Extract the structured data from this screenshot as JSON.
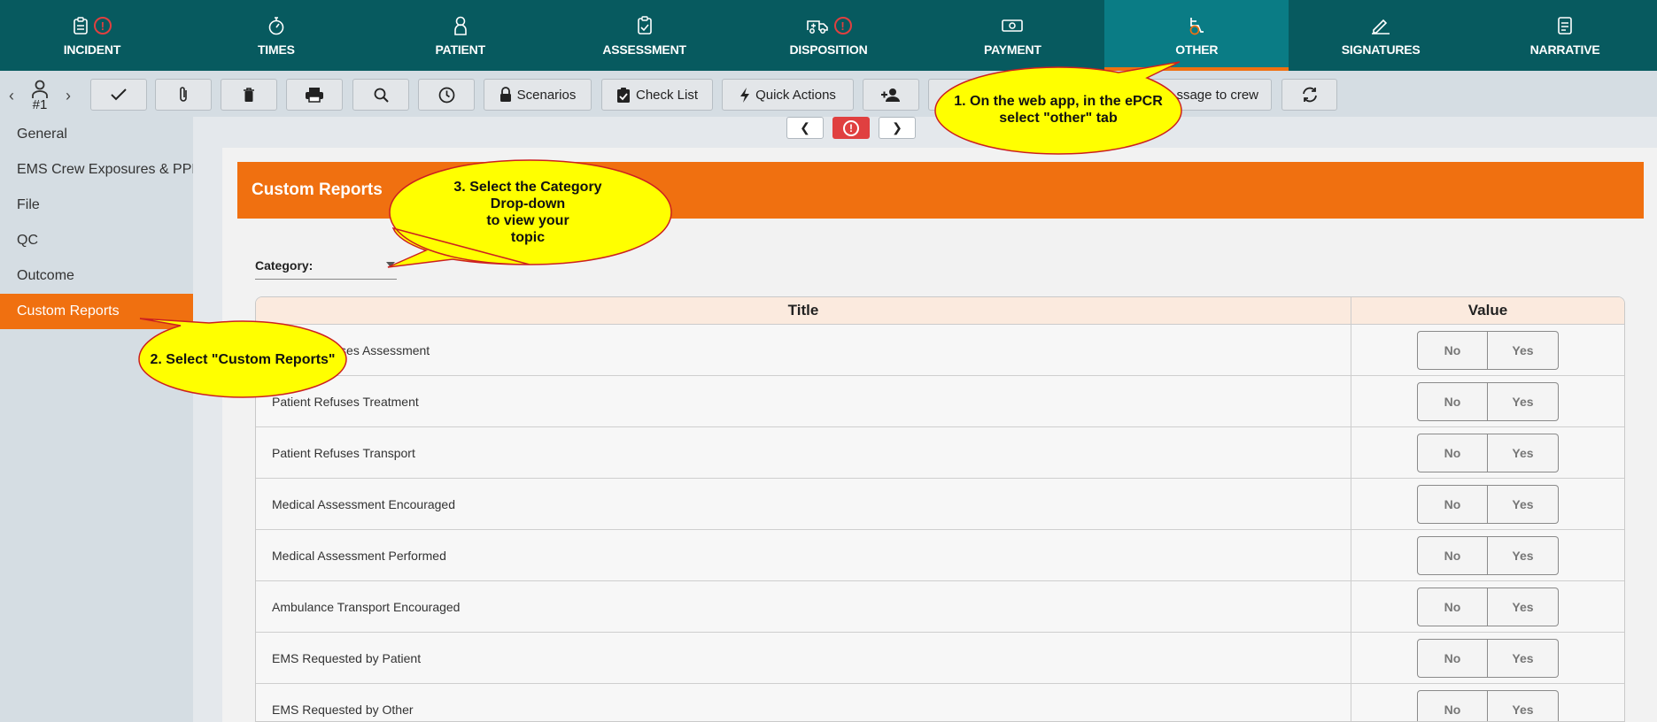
{
  "tabs": [
    {
      "label": "INCIDENT",
      "icon": "clipboard-icon",
      "alert": true,
      "active": false
    },
    {
      "label": "TIMES",
      "icon": "stopwatch-icon",
      "alert": false,
      "active": false
    },
    {
      "label": "PATIENT",
      "icon": "person-icon",
      "alert": false,
      "active": false
    },
    {
      "label": "ASSESSMENT",
      "icon": "clipboard-check-icon",
      "alert": false,
      "active": false
    },
    {
      "label": "DISPOSITION",
      "icon": "ambulance-icon",
      "alert": true,
      "active": false
    },
    {
      "label": "PAYMENT",
      "icon": "money-icon",
      "alert": false,
      "active": false
    },
    {
      "label": "OTHER",
      "icon": "wheelchair-icon",
      "alert": false,
      "active": true
    },
    {
      "label": "SIGNATURES",
      "icon": "signature-icon",
      "alert": false,
      "active": false
    },
    {
      "label": "NARRATIVE",
      "icon": "document-icon",
      "alert": false,
      "active": false
    }
  ],
  "toolbar": {
    "patient_number": "#1",
    "scenarios_label": "Scenarios",
    "checklist_label": "Check List",
    "quick_actions_label": "Quick Actions",
    "message_crew_label": "ssage to crew"
  },
  "sidebar": {
    "items": [
      {
        "label": "General"
      },
      {
        "label": "EMS Crew Exposures & PPE"
      },
      {
        "label": "File"
      },
      {
        "label": "QC"
      },
      {
        "label": "Outcome"
      },
      {
        "label": "Custom Reports",
        "active": true
      }
    ]
  },
  "main": {
    "section_title": "Custom Reports",
    "category_label": "Category:",
    "table": {
      "headers": {
        "title": "Title",
        "value": "Value"
      },
      "no_label": "No",
      "yes_label": "Yes",
      "rows": [
        {
          "title": "Patient Refuses Assessment"
        },
        {
          "title": "Patient Refuses Treatment"
        },
        {
          "title": "Patient Refuses Transport"
        },
        {
          "title": "Medical Assessment Encouraged"
        },
        {
          "title": "Medical Assessment Performed"
        },
        {
          "title": "Ambulance Transport Encouraged"
        },
        {
          "title": "EMS Requested by Patient"
        },
        {
          "title": "EMS Requested by Other"
        }
      ]
    }
  },
  "callouts": {
    "step1": "1. On the web app, in the ePCR\nselect \"other\" tab",
    "step2": "2. Select \"Custom Reports\"",
    "step3": "3. Select the Category\nDrop-down\nto view your\ntopic"
  },
  "colors": {
    "nav_bg": "#075a5f",
    "nav_active": "#0a7c85",
    "accent_orange": "#f07010",
    "callout_fill": "#ffff00",
    "callout_border": "#cc2020",
    "alert_red": "#e04040"
  }
}
